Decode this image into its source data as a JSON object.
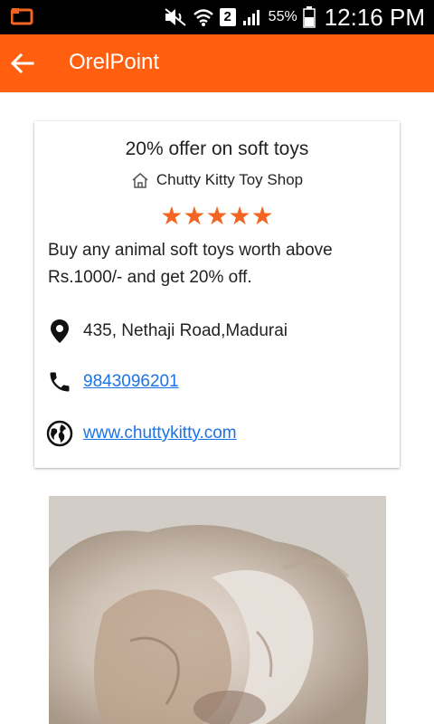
{
  "status_bar": {
    "sim_slot": "2",
    "battery_percent": "55%",
    "time": "12:16 PM"
  },
  "app_bar": {
    "title": "OrelPoint"
  },
  "offer": {
    "title": "20% offer on soft toys",
    "shop_name": "Chutty Kitty Toy Shop",
    "rating": 5,
    "stars": "★★★★★",
    "description": "Buy any animal soft toys worth above Rs.1000/- and get 20% off.",
    "address": "435, Nethaji Road,Madurai",
    "phone": "9843096201",
    "website": "www.chuttykitty.com"
  },
  "colors": {
    "accent": "#ff5f0f",
    "star": "#f26522",
    "link": "#1a73e8"
  }
}
